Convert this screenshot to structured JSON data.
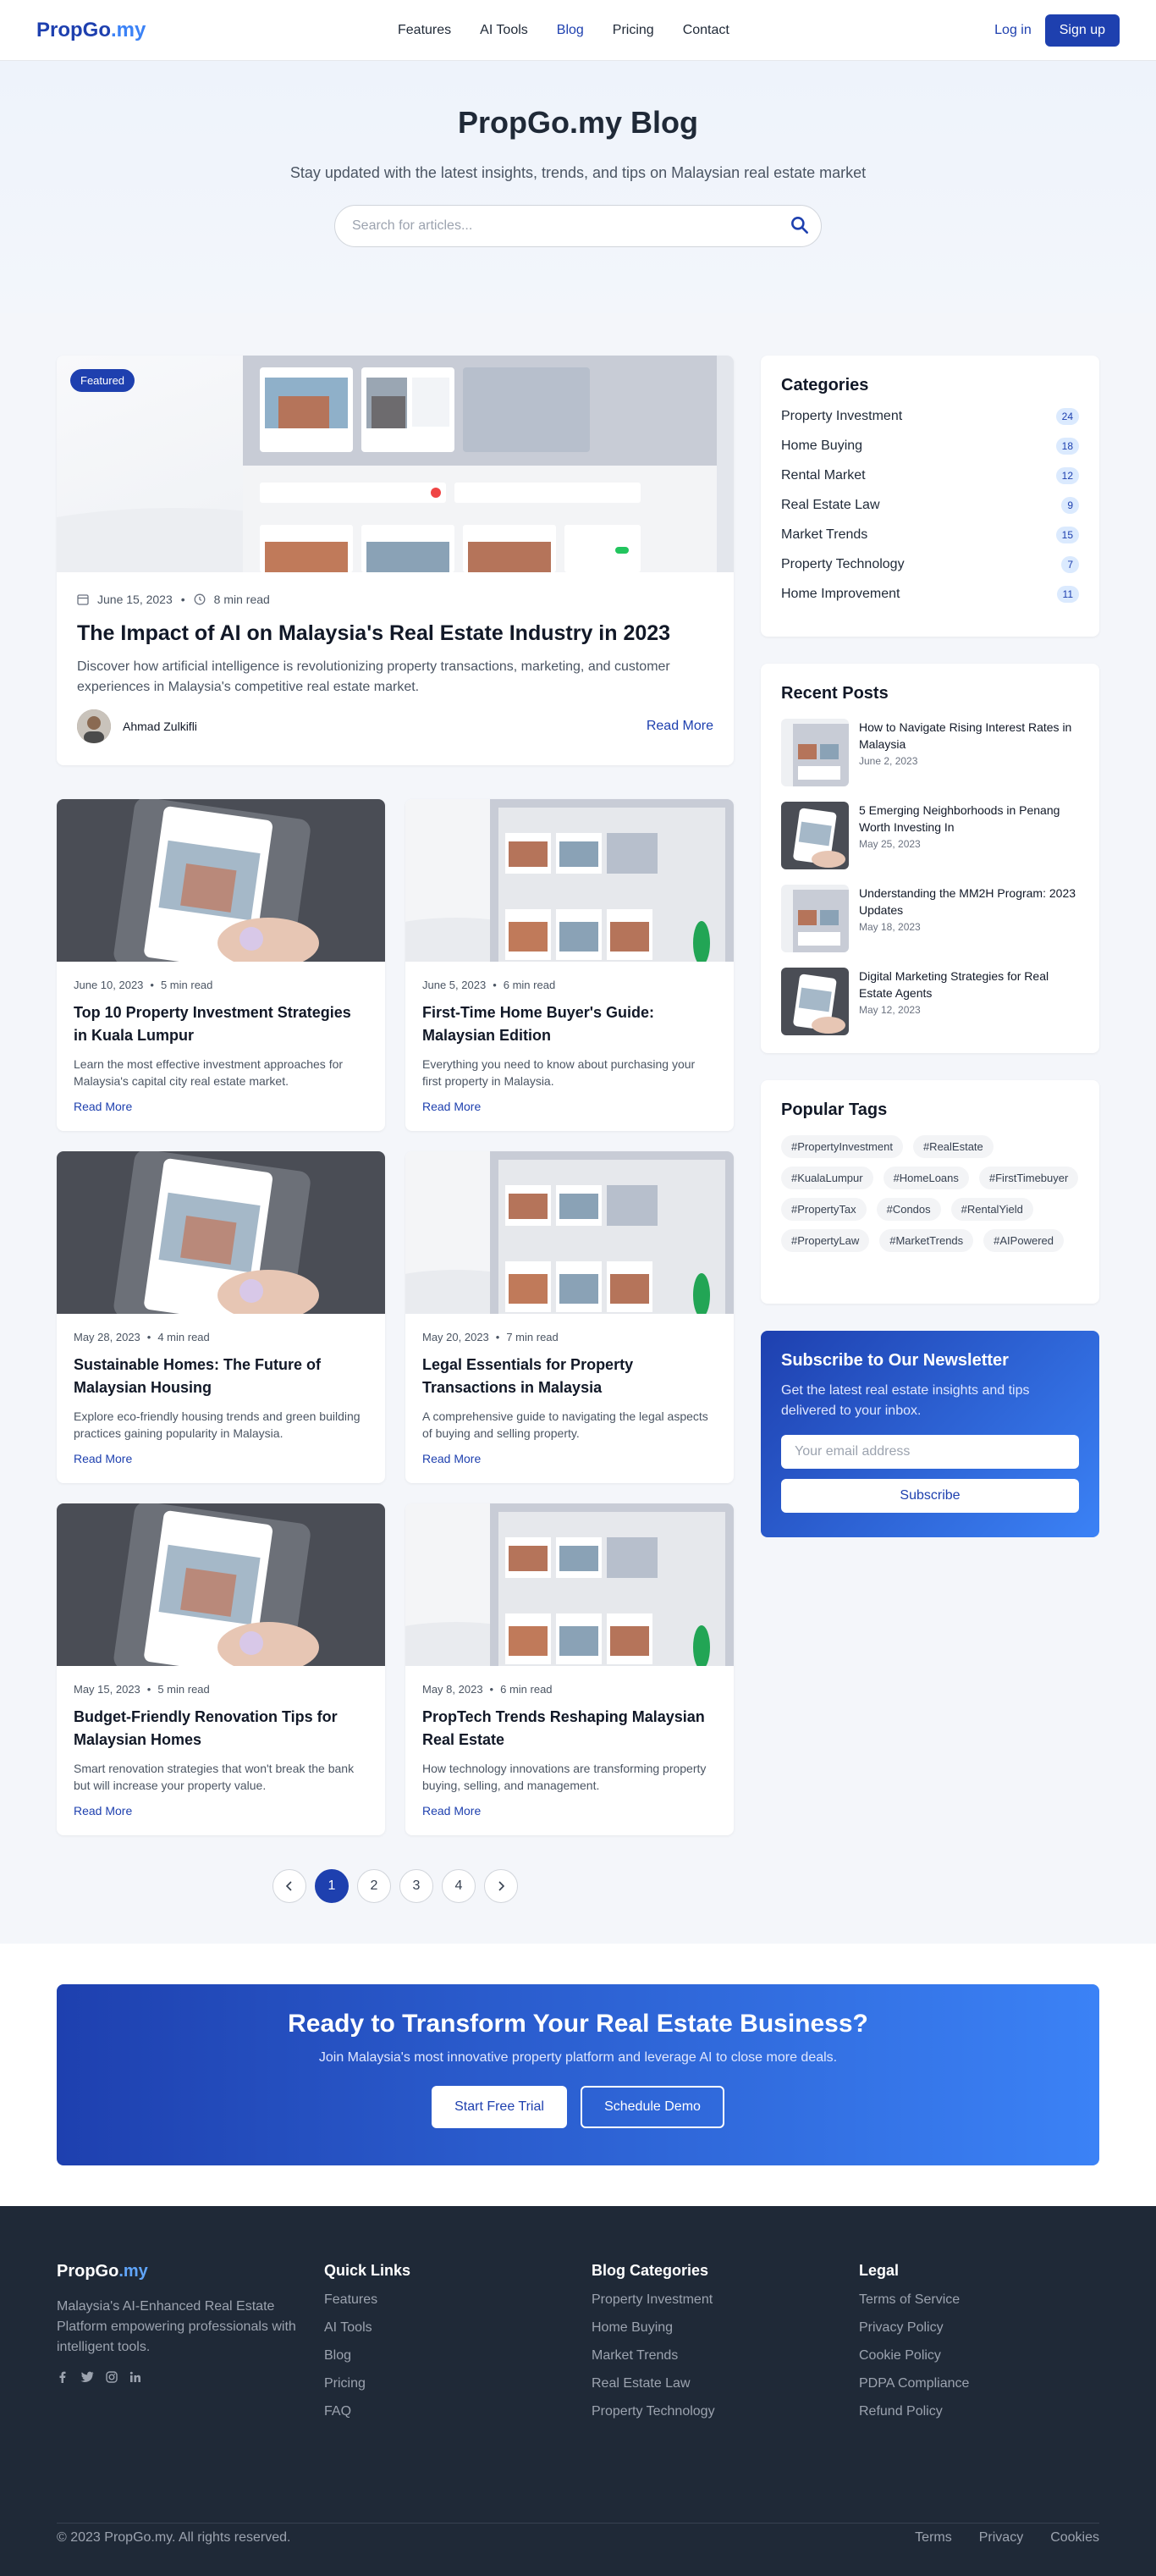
{
  "nav": {
    "logo_main": "PropGo",
    "logo_suffix": ".my",
    "links": [
      "Features",
      "AI Tools",
      "Blog",
      "Pricing",
      "Contact"
    ],
    "login": "Log in",
    "signup": "Sign up"
  },
  "hero": {
    "title": "PropGo.my Blog",
    "subtitle": "Stay updated with the latest insights, trends, and tips on Malaysian real estate market",
    "search_placeholder": "Search for articles..."
  },
  "featured": {
    "badge": "Featured",
    "date": "June 15, 2023",
    "read_time": "8 min read",
    "title": "The Impact of AI on Malaysia's Real Estate Industry in 2023",
    "excerpt": "Discover how artificial intelligence is revolutionizing property transactions, marketing, and customer experiences in Malaysia's competitive real estate market.",
    "author": "Ahmad Zulkifli",
    "read_more": "Read More"
  },
  "posts": [
    {
      "date": "June 10, 2023",
      "read_time": "5 min read",
      "title": "Top 10 Property Investment Strategies in Kuala Lumpur",
      "excerpt": "Learn the most effective investment approaches for Malaysia's capital city real estate market.",
      "read_more": "Read More"
    },
    {
      "date": "June 5, 2023",
      "read_time": "6 min read",
      "title": "First-Time Home Buyer's Guide: Malaysian Edition",
      "excerpt": "Everything you need to know about purchasing your first property in Malaysia.",
      "read_more": "Read More"
    },
    {
      "date": "May 28, 2023",
      "read_time": "4 min read",
      "title": "Sustainable Homes: The Future of Malaysian Housing",
      "excerpt": "Explore eco-friendly housing trends and green building practices gaining popularity in Malaysia.",
      "read_more": "Read More"
    },
    {
      "date": "May 20, 2023",
      "read_time": "7 min read",
      "title": "Legal Essentials for Property Transactions in Malaysia",
      "excerpt": "A comprehensive guide to navigating the legal aspects of buying and selling property.",
      "read_more": "Read More"
    },
    {
      "date": "May 15, 2023",
      "read_time": "5 min read",
      "title": "Budget-Friendly Renovation Tips for Malaysian Homes",
      "excerpt": "Smart renovation strategies that won't break the bank but will increase your property value.",
      "read_more": "Read More"
    },
    {
      "date": "May 8, 2023",
      "read_time": "6 min read",
      "title": "PropTech Trends Reshaping Malaysian Real Estate",
      "excerpt": "How technology innovations are transforming property buying, selling, and management.",
      "read_more": "Read More"
    }
  ],
  "pagination": {
    "pages": [
      "1",
      "2",
      "3",
      "4"
    ],
    "current": 1
  },
  "categories": {
    "title": "Categories",
    "items": [
      {
        "name": "Property Investment",
        "count": "24"
      },
      {
        "name": "Home Buying",
        "count": "18"
      },
      {
        "name": "Rental Market",
        "count": "12"
      },
      {
        "name": "Real Estate Law",
        "count": "9"
      },
      {
        "name": "Market Trends",
        "count": "15"
      },
      {
        "name": "Property Technology",
        "count": "7"
      },
      {
        "name": "Home Improvement",
        "count": "11"
      }
    ]
  },
  "recent": {
    "title": "Recent Posts",
    "items": [
      {
        "title": "How to Navigate Rising Interest Rates in Malaysia",
        "date": "June 2, 2023"
      },
      {
        "title": "5 Emerging Neighborhoods in Penang Worth Investing In",
        "date": "May 25, 2023"
      },
      {
        "title": "Understanding the MM2H Program: 2023 Updates",
        "date": "May 18, 2023"
      },
      {
        "title": "Digital Marketing Strategies for Real Estate Agents",
        "date": "May 12, 2023"
      }
    ]
  },
  "tags": {
    "title": "Popular Tags",
    "items": [
      "#PropertyInvestment",
      "#RealEstate",
      "#KualaLumpur",
      "#HomeLoans",
      "#FirstTimebuyer",
      "#PropertyTax",
      "#Condos",
      "#RentalYield",
      "#PropertyLaw",
      "#MarketTrends",
      "#AIPowered"
    ]
  },
  "newsletter": {
    "title": "Subscribe to Our Newsletter",
    "text": "Get the latest real estate insights and tips delivered to your inbox.",
    "placeholder": "Your email address",
    "button": "Subscribe"
  },
  "cta": {
    "title": "Ready to Transform Your Real Estate Business?",
    "text": "Join Malaysia's most innovative property platform and leverage AI to close more deals.",
    "primary": "Start Free Trial",
    "secondary": "Schedule Demo"
  },
  "footer": {
    "logo_main": "PropGo",
    "logo_suffix": ".my",
    "description": "Malaysia's AI-Enhanced Real Estate Platform empowering professionals with intelligent tools.",
    "quick_links": {
      "title": "Quick Links",
      "items": [
        "Features",
        "AI Tools",
        "Blog",
        "Pricing",
        "FAQ"
      ]
    },
    "blog_categories": {
      "title": "Blog Categories",
      "items": [
        "Property Investment",
        "Home Buying",
        "Market Trends",
        "Real Estate Law",
        "Property Technology"
      ]
    },
    "legal": {
      "title": "Legal",
      "items": [
        "Terms of Service",
        "Privacy Policy",
        "Cookie Policy",
        "PDPA Compliance",
        "Refund Policy"
      ]
    },
    "copyright": "© 2023 PropGo.my. All rights reserved.",
    "bottom_links": [
      "Terms",
      "Privacy",
      "Cookies"
    ]
  },
  "colors": {
    "brand": "#1e40af",
    "accent": "#3b82f6",
    "footer_bg": "#1f2937"
  }
}
